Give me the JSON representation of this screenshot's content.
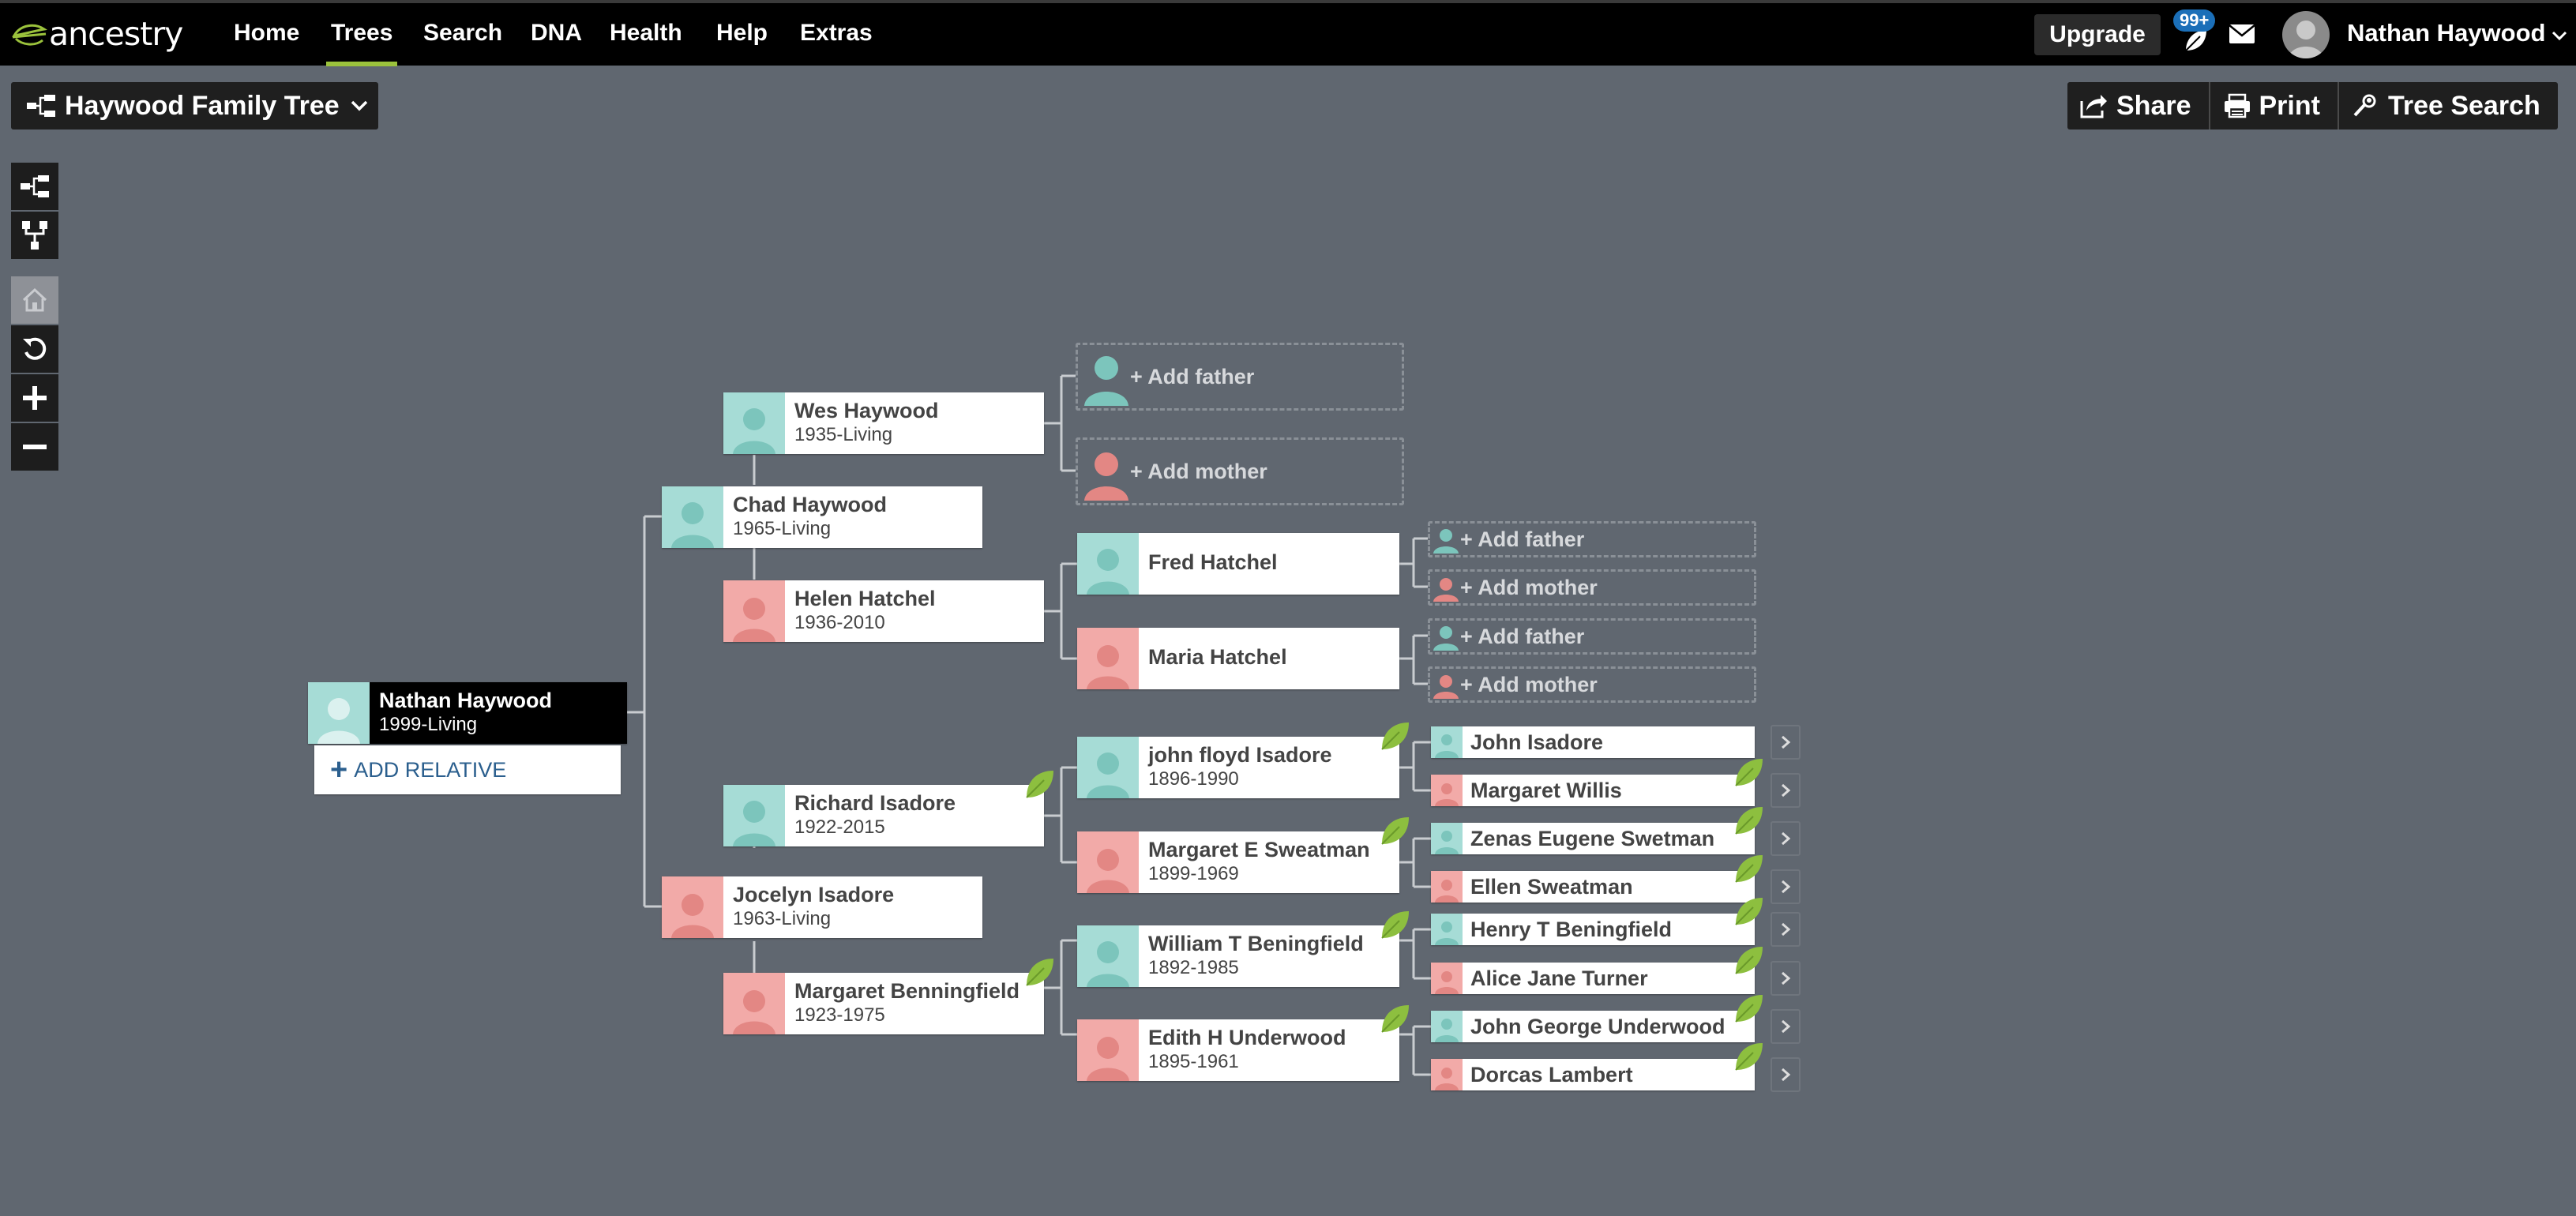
{
  "brand": {
    "logo_text": "ancestry"
  },
  "nav": {
    "items": [
      {
        "label": "Home",
        "active": false
      },
      {
        "label": "Trees",
        "active": true
      },
      {
        "label": "Search",
        "active": false
      },
      {
        "label": "DNA",
        "active": false
      },
      {
        "label": "Health",
        "active": false
      },
      {
        "label": "Help",
        "active": false
      },
      {
        "label": "Extras",
        "active": false
      }
    ],
    "upgrade_label": "Upgrade",
    "notification_count": "99+",
    "user_name": "Nathan Haywood"
  },
  "toolbar": {
    "tree_name": "Haywood Family Tree",
    "share_label": "Share",
    "print_label": "Print",
    "tree_search_label": "Tree Search"
  },
  "view_tools": [
    "pedigree-view-icon",
    "family-view-icon",
    "home-icon",
    "reset-icon",
    "zoom-in-icon",
    "zoom-out-icon"
  ],
  "colors": {
    "background": "#606770",
    "male": "#a6dcd6",
    "female": "#f2aaa8",
    "hint_leaf": "#8dbf3f",
    "active_nav": "#9bc23c"
  },
  "tree": {
    "root": {
      "name": "Nathan Haywood",
      "dates": "1999-Living"
    },
    "add_relative_label": "ADD RELATIVE",
    "parents": {
      "father": {
        "name": "Chad Haywood",
        "dates": "1965-Living"
      },
      "mother": {
        "name": "Jocelyn Isadore",
        "dates": "1963-Living"
      }
    },
    "grandparents": {
      "paternal_grandfather": {
        "name": "Wes Haywood",
        "dates": "1935-Living"
      },
      "paternal_grandmother": {
        "name": "Helen Hatchel",
        "dates": "1936-2010"
      },
      "maternal_grandfather": {
        "name": "Richard Isadore",
        "dates": "1922-2015"
      },
      "maternal_grandmother": {
        "name": "Margaret Benningfield",
        "dates": "1923-1975"
      }
    },
    "great_grandparents": {
      "wes_father_add": "Add father",
      "wes_mother_add": "Add mother",
      "helen_father": {
        "name": "Fred Hatchel"
      },
      "helen_mother": {
        "name": "Maria Hatchel"
      },
      "richard_father": {
        "name": "john floyd Isadore",
        "dates": "1896-1990"
      },
      "richard_mother": {
        "name": "Margaret E Sweatman",
        "dates": "1899-1969"
      },
      "margaret_father": {
        "name": "William T Beningfield",
        "dates": "1892-1985"
      },
      "margaret_mother": {
        "name": "Edith H Underwood",
        "dates": "1895-1961"
      }
    },
    "gen4_adds": {
      "fred_father": "Add father",
      "fred_mother": "Add mother",
      "maria_father": "Add father",
      "maria_mother": "Add mother"
    },
    "gen4": [
      {
        "name": "John Isadore"
      },
      {
        "name": "Margaret Willis"
      },
      {
        "name": "Zenas Eugene Swetman"
      },
      {
        "name": "Ellen Sweatman"
      },
      {
        "name": "Henry T Beningfield"
      },
      {
        "name": "Alice Jane Turner"
      },
      {
        "name": "John George Underwood"
      },
      {
        "name": "Dorcas Lambert"
      }
    ]
  }
}
